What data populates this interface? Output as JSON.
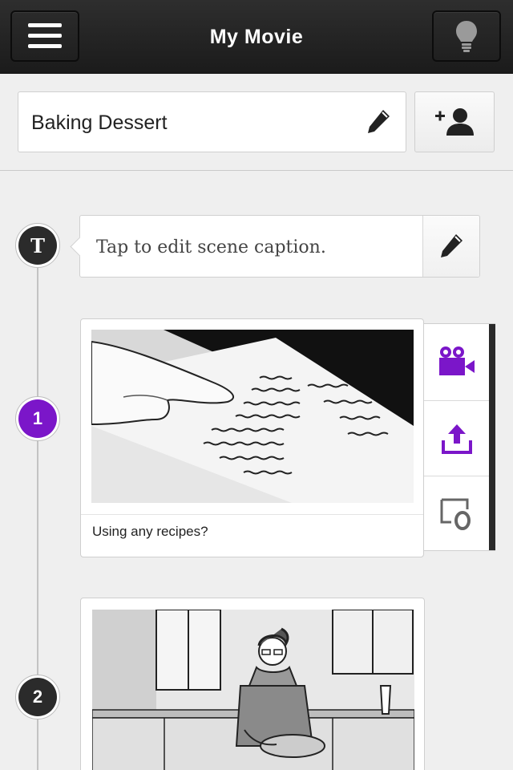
{
  "header": {
    "title": "My Movie",
    "menu_icon": "hamburger-icon",
    "idea_icon": "lightbulb-icon"
  },
  "movie": {
    "name": "Baking Dessert",
    "edit_icon": "pencil-icon",
    "add_collaborator_icon": "add-person-icon"
  },
  "title_node": {
    "label": "T",
    "caption_placeholder": "Tap to edit scene caption."
  },
  "scenes": [
    {
      "number": "1",
      "caption": "Using any recipes?",
      "active": true,
      "actions": [
        "video-camera-icon",
        "share-upload-icon",
        "duplicate-icon"
      ]
    },
    {
      "number": "2",
      "caption": ""
    }
  ],
  "colors": {
    "accent": "#7b16c9",
    "header_bg": "#222222",
    "background": "#efefef"
  }
}
